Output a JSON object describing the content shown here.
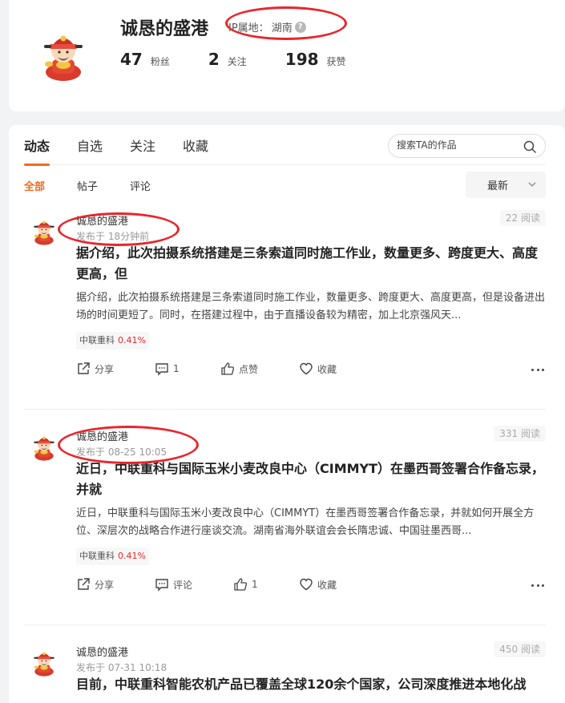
{
  "profile": {
    "username": "诚恳的盛港",
    "ip_label": "IP属地：",
    "ip_value": "湖南",
    "help_glyph": "?",
    "stats": [
      {
        "num": "47",
        "label": "粉丝"
      },
      {
        "num": "2",
        "label": "关注"
      },
      {
        "num": "198",
        "label": "获赞"
      }
    ]
  },
  "tabs": [
    "动态",
    "自选",
    "关注",
    "收藏"
  ],
  "search": {
    "placeholder": "搜索TA的作品"
  },
  "subtabs": [
    "全部",
    "帖子",
    "评论"
  ],
  "sort": {
    "label": "最新"
  },
  "posts": [
    {
      "author": "诚恳的盛港",
      "time": "发布于 18分钟前",
      "reads": "22 阅读",
      "title": "据介绍，此次拍摄系统搭建是三条索道同时施工作业，数量更多、跨度更大、高度更高，但",
      "summary": "据介绍，此次拍摄系统搭建是三条索道同时施工作业，数量更多、跨度更大、高度更高，但是设备进出场的时间更短了。同时，在搭建过程中，由于直播设备较为精密，加上北京强风天...",
      "stock_name": "中联重科",
      "stock_change": "0.41%",
      "share": "分享",
      "comment": "1",
      "like": "点赞",
      "collect": "收藏"
    },
    {
      "author": "诚恳的盛港",
      "time": "发布于 08-25 10:05",
      "reads": "331 阅读",
      "title": "近日，中联重科与国际玉米小麦改良中心（CIMMYT）在墨西哥签署合作备忘录，并就",
      "summary": "近日，中联重科与国际玉米小麦改良中心（CIMMYT）在墨西哥签署合作备忘录，并就如何开展全方位、深层次的战略合作进行座谈交流。湖南省海外联谊会会长隋忠诚、中国驻墨西哥...",
      "stock_name": "中联重科",
      "stock_change": "0.41%",
      "share": "分享",
      "comment": "评论",
      "like": "1",
      "collect": "收藏"
    },
    {
      "author": "诚恳的盛港",
      "time": "发布于 07-31 10:18",
      "reads": "450 阅读",
      "title": "目前，中联重科智能农机产品已覆盖全球120余个国家，公司深度推进本地化战"
    }
  ],
  "colors": {
    "accent": "#f26b1d",
    "highlight_circle": "#e8262d",
    "stock_up": "#e8262d"
  }
}
